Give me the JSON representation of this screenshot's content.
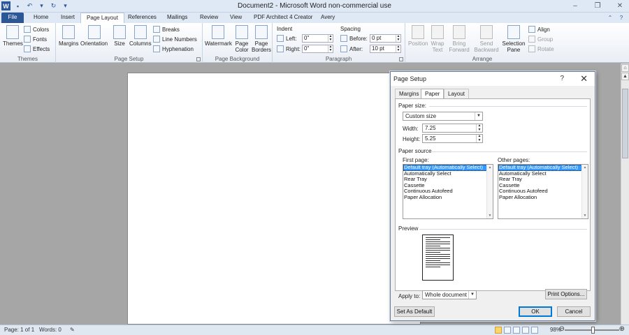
{
  "window": {
    "title": "Document2  -  Microsoft Word non-commercial use"
  },
  "tabs": [
    {
      "label": "File"
    },
    {
      "label": "Home"
    },
    {
      "label": "Insert"
    },
    {
      "label": "Page Layout"
    },
    {
      "label": "References"
    },
    {
      "label": "Mailings"
    },
    {
      "label": "Review"
    },
    {
      "label": "View"
    },
    {
      "label": "PDF Architect 4 Creator"
    },
    {
      "label": "Avery"
    }
  ],
  "ribbon": {
    "themes": {
      "themes": "Themes",
      "colors": "Colors",
      "fonts": "Fonts",
      "effects": "Effects",
      "group": "Themes"
    },
    "page_setup": {
      "margins": "Margins",
      "orientation": "Orientation",
      "size": "Size",
      "columns": "Columns",
      "breaks": "Breaks",
      "line_numbers": "Line Numbers",
      "hyphenation": "Hyphenation",
      "group": "Page Setup"
    },
    "page_background": {
      "watermark": "Watermark",
      "page_color": "Page Color",
      "page_borders": "Page Borders",
      "group": "Page Background"
    },
    "paragraph": {
      "indent_label": "Indent",
      "left_label": "Left:",
      "left_value": "0\"",
      "right_label": "Right:",
      "right_value": "0\"",
      "spacing_label": "Spacing",
      "before_label": "Before:",
      "before_value": "0 pt",
      "after_label": "After:",
      "after_value": "10 pt",
      "group": "Paragraph"
    },
    "arrange": {
      "position": "Position",
      "wrap_text": "Wrap Text",
      "bring_forward": "Bring Forward",
      "send_backward": "Send Backward",
      "selection_pane": "Selection Pane",
      "align": "Align",
      "group_btn": "Group",
      "rotate": "Rotate",
      "group": "Arrange"
    }
  },
  "dialog": {
    "title": "Page Setup",
    "help": "?",
    "tabs": [
      {
        "label": "Margins"
      },
      {
        "label": "Paper"
      },
      {
        "label": "Layout"
      }
    ],
    "paper_size_label": "Paper size:",
    "paper_size_value": "Custom size",
    "width_label": "Width:",
    "width_value": "7.25",
    "height_label": "Height:",
    "height_value": "5.25",
    "paper_source_label": "Paper source",
    "first_page_label": "First page:",
    "other_pages_label": "Other pages:",
    "first_page_items": [
      "Default tray (Automatically Select)",
      "Automatically Select",
      "Rear Tray",
      "Cassette",
      "Continuous Autofeed",
      "Paper Allocation"
    ],
    "other_pages_items": [
      "Default tray (Automatically Select)",
      "Automatically Select",
      "Rear Tray",
      "Cassette",
      "Continuous Autofeed",
      "Paper Allocation"
    ],
    "preview_label": "Preview",
    "apply_to_label": "Apply to:",
    "apply_to_value": "Whole document",
    "print_options": "Print Options...",
    "set_as_default": "Set As Default",
    "ok": "OK",
    "cancel": "Cancel"
  },
  "status": {
    "page": "Page: 1 of 1",
    "words": "Words: 0",
    "zoom": "98%"
  }
}
